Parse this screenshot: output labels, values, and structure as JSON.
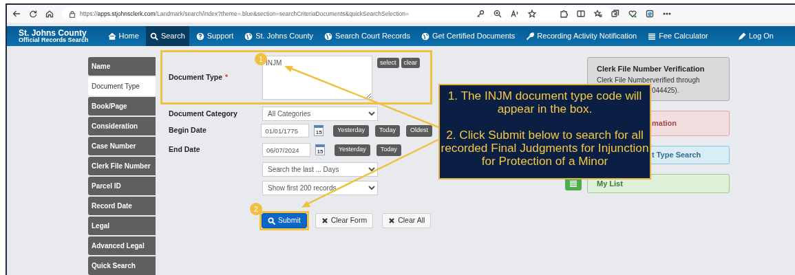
{
  "browser": {
    "url": "https://apps.stjohnsclerk.com/Landmark/search/index?theme=.blue&section=searchCriteriaDocuments&quickSearchSelection="
  },
  "navbar": {
    "brand_title": "St. Johns County",
    "brand_subtitle": "Official Records Search",
    "items": [
      {
        "label": "Home",
        "selected": false
      },
      {
        "label": "Search",
        "selected": true
      },
      {
        "label": "Support",
        "selected": false
      },
      {
        "label": "St. Johns County",
        "selected": false
      },
      {
        "label": "Search Court Records",
        "selected": false
      },
      {
        "label": "Get Certified Documents",
        "selected": false
      },
      {
        "label": "Recording Activity Notification",
        "selected": false
      },
      {
        "label": "Fee Calculator",
        "selected": false
      }
    ],
    "login": "Log On"
  },
  "sidebar": {
    "items": [
      {
        "label": "Name",
        "selected": false
      },
      {
        "label": "Document Type",
        "selected": true
      },
      {
        "label": "Book/Page",
        "selected": false
      },
      {
        "label": "Consideration",
        "selected": false
      },
      {
        "label": "Case Number",
        "selected": false
      },
      {
        "label": "Clerk File Number",
        "selected": false
      },
      {
        "label": "Parcel ID",
        "selected": false
      },
      {
        "label": "Record Date",
        "selected": false
      },
      {
        "label": "Legal",
        "selected": false
      },
      {
        "label": "Advanced Legal",
        "selected": false
      },
      {
        "label": "Quick Search",
        "selected": false
      }
    ]
  },
  "form": {
    "document_type": {
      "label": "Document Type",
      "required_marker": "*",
      "value": "INJM",
      "buttons": [
        "select",
        "clear"
      ]
    },
    "document_category": {
      "label": "Document Category",
      "value": "All Categories"
    },
    "begin_date": {
      "label": "Begin Date",
      "value": "01/01/1775",
      "calendar_day": "15",
      "buttons": [
        "Yesterday",
        "Today",
        "Oldest"
      ]
    },
    "end_date": {
      "label": "End Date",
      "value": "06/07/2024",
      "calendar_day": "15",
      "buttons": [
        "Yesterday",
        "Today"
      ]
    },
    "days_select": {
      "value": "Search the last ... Days"
    },
    "records_select": {
      "value": "Show first 200 records"
    },
    "actions": [
      {
        "label": "Submit",
        "kind": "primary"
      },
      {
        "label": "Clear Form",
        "kind": "clear"
      },
      {
        "label": "Clear All",
        "kind": "clear"
      }
    ]
  },
  "panels": [
    {
      "kind": "gray",
      "title": {
        "text": "Clerk File Number Verification",
        "covered": false
      },
      "lines": [
        {
          "text": "Clerk File Numberverified through",
          "covered": false
        },
        {
          "text": "044425).",
          "covered": true
        }
      ]
    },
    {
      "kind": "red",
      "title": {
        "text": "mation",
        "covered": true
      }
    },
    {
      "kind": "blue",
      "title": {
        "text": "t Type Search",
        "covered": true
      }
    },
    {
      "kind": "green",
      "title": {
        "text": "My List",
        "covered": false
      }
    }
  ],
  "callout": {
    "steps": [
      "1. The INJM document type code will appear in the box.",
      "2. Click Submit below to search for all recorded Final Judgments for Injunction for Protection of a Minor"
    ]
  },
  "badges": [
    "1",
    "2"
  ]
}
